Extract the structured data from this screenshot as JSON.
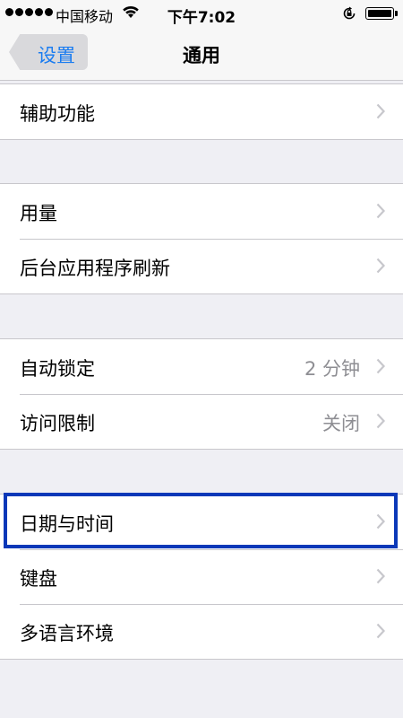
{
  "status_bar": {
    "carrier": "中国移动",
    "time": "下午7:02",
    "signal_icon": "signal-dots-icon",
    "wifi_icon": "wifi-icon",
    "lock_icon": "rotation-lock-icon",
    "battery_icon": "battery-icon",
    "battery_level": 1.0
  },
  "nav": {
    "back_label": "设置",
    "title": "通用"
  },
  "groups": [
    {
      "rows": [
        {
          "label": "辅助功能",
          "value": ""
        }
      ]
    },
    {
      "rows": [
        {
          "label": "用量",
          "value": ""
        },
        {
          "label": "后台应用程序刷新",
          "value": ""
        }
      ]
    },
    {
      "rows": [
        {
          "label": "自动锁定",
          "value": "2 分钟"
        },
        {
          "label": "访问限制",
          "value": "关闭"
        }
      ]
    },
    {
      "rows": [
        {
          "label": "日期与时间",
          "value": ""
        },
        {
          "label": "键盘",
          "value": ""
        },
        {
          "label": "多语言环境",
          "value": ""
        }
      ]
    }
  ],
  "colors": {
    "accent": "#1a7cf0",
    "highlight_border": "#0a38b8",
    "background": "#efeff4",
    "secondary_text": "#8e8e93"
  }
}
